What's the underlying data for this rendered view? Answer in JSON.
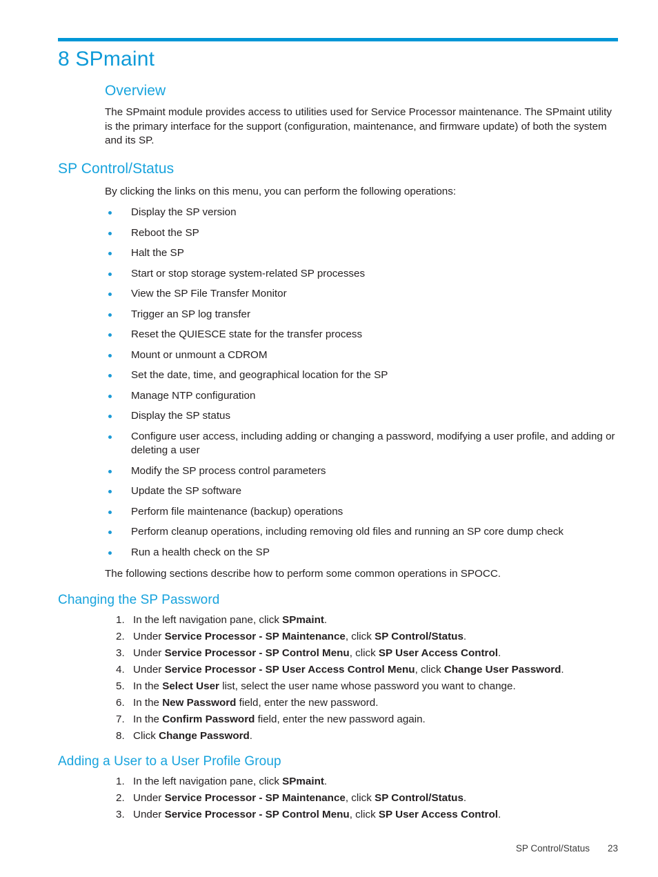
{
  "colors": {
    "accent_blue": "#0096d6",
    "heading_blue": "#17a3dd",
    "bullet_blue": "#1b9ad6",
    "body_text": "#231f20"
  },
  "chapter": {
    "number_and_title": "8 SPmaint"
  },
  "overview": {
    "heading": "Overview",
    "paragraph": "The SPmaint module provides access to utilities used for Service Processor maintenance. The SPmaint utility is the primary interface for the support (configuration, maintenance, and firmware update) of both the system and its SP."
  },
  "sp_control_status": {
    "heading": "SP Control/Status",
    "intro": "By clicking the links on this menu, you can perform the following operations:",
    "bullets": [
      "Display the SP version",
      "Reboot the SP",
      "Halt the SP",
      "Start or stop storage system-related SP processes",
      "View the SP File Transfer Monitor",
      "Trigger an SP log transfer",
      "Reset the QUIESCE state for the transfer process",
      "Mount or unmount a CDROM",
      "Set the date, time, and geographical location for the SP",
      "Manage NTP configuration",
      "Display the SP status",
      "Configure user access, including adding or changing a password, modifying a user profile, and adding or deleting a user",
      "Modify the SP process control parameters",
      "Update the SP software",
      "Perform file maintenance (backup) operations",
      "Perform cleanup operations, including removing old files and running an SP core dump check",
      "Run a health check on the SP"
    ],
    "closing": "The following sections describe how to perform some common operations in SPOCC."
  },
  "changing_password": {
    "heading": "Changing the SP Password",
    "steps": [
      {
        "number": "1.",
        "parts": [
          {
            "text": "In the left navigation pane, click ",
            "bold": false
          },
          {
            "text": "SPmaint",
            "bold": true
          },
          {
            "text": ".",
            "bold": false
          }
        ]
      },
      {
        "number": "2.",
        "parts": [
          {
            "text": "Under ",
            "bold": false
          },
          {
            "text": "Service Processor - SP Maintenance",
            "bold": true
          },
          {
            "text": ", click ",
            "bold": false
          },
          {
            "text": "SP Control/Status",
            "bold": true
          },
          {
            "text": ".",
            "bold": false
          }
        ]
      },
      {
        "number": "3.",
        "parts": [
          {
            "text": "Under ",
            "bold": false
          },
          {
            "text": "Service Processor - SP Control Menu",
            "bold": true
          },
          {
            "text": ", click ",
            "bold": false
          },
          {
            "text": "SP User Access Control",
            "bold": true
          },
          {
            "text": ".",
            "bold": false
          }
        ]
      },
      {
        "number": "4.",
        "parts": [
          {
            "text": "Under ",
            "bold": false
          },
          {
            "text": "Service Processor - SP User Access Control Menu",
            "bold": true
          },
          {
            "text": ", click ",
            "bold": false
          },
          {
            "text": "Change User Password",
            "bold": true
          },
          {
            "text": ".",
            "bold": false
          }
        ]
      },
      {
        "number": "5.",
        "parts": [
          {
            "text": "In the ",
            "bold": false
          },
          {
            "text": "Select User",
            "bold": true
          },
          {
            "text": " list, select the user name whose password you want to change.",
            "bold": false
          }
        ]
      },
      {
        "number": "6.",
        "parts": [
          {
            "text": "In the ",
            "bold": false
          },
          {
            "text": "New Password",
            "bold": true
          },
          {
            "text": " field, enter the new password.",
            "bold": false
          }
        ]
      },
      {
        "number": "7.",
        "parts": [
          {
            "text": "In the ",
            "bold": false
          },
          {
            "text": "Confirm Password",
            "bold": true
          },
          {
            "text": " field, enter the new password again.",
            "bold": false
          }
        ]
      },
      {
        "number": "8.",
        "parts": [
          {
            "text": "Click ",
            "bold": false
          },
          {
            "text": "Change Password",
            "bold": true
          },
          {
            "text": ".",
            "bold": false
          }
        ]
      }
    ]
  },
  "adding_user": {
    "heading": "Adding a User to a User Profile Group",
    "steps": [
      {
        "number": "1.",
        "parts": [
          {
            "text": "In the left navigation pane, click ",
            "bold": false
          },
          {
            "text": "SPmaint",
            "bold": true
          },
          {
            "text": ".",
            "bold": false
          }
        ]
      },
      {
        "number": "2.",
        "parts": [
          {
            "text": "Under ",
            "bold": false
          },
          {
            "text": "Service Processor - SP Maintenance",
            "bold": true
          },
          {
            "text": ", click ",
            "bold": false
          },
          {
            "text": "SP Control/Status",
            "bold": true
          },
          {
            "text": ".",
            "bold": false
          }
        ]
      },
      {
        "number": "3.",
        "parts": [
          {
            "text": "Under ",
            "bold": false
          },
          {
            "text": "Service Processor - SP Control Menu",
            "bold": true
          },
          {
            "text": ", click ",
            "bold": false
          },
          {
            "text": "SP User Access Control",
            "bold": true
          },
          {
            "text": ".",
            "bold": false
          }
        ]
      }
    ]
  },
  "footer": {
    "section_label": "SP Control/Status",
    "page_number": "23"
  }
}
